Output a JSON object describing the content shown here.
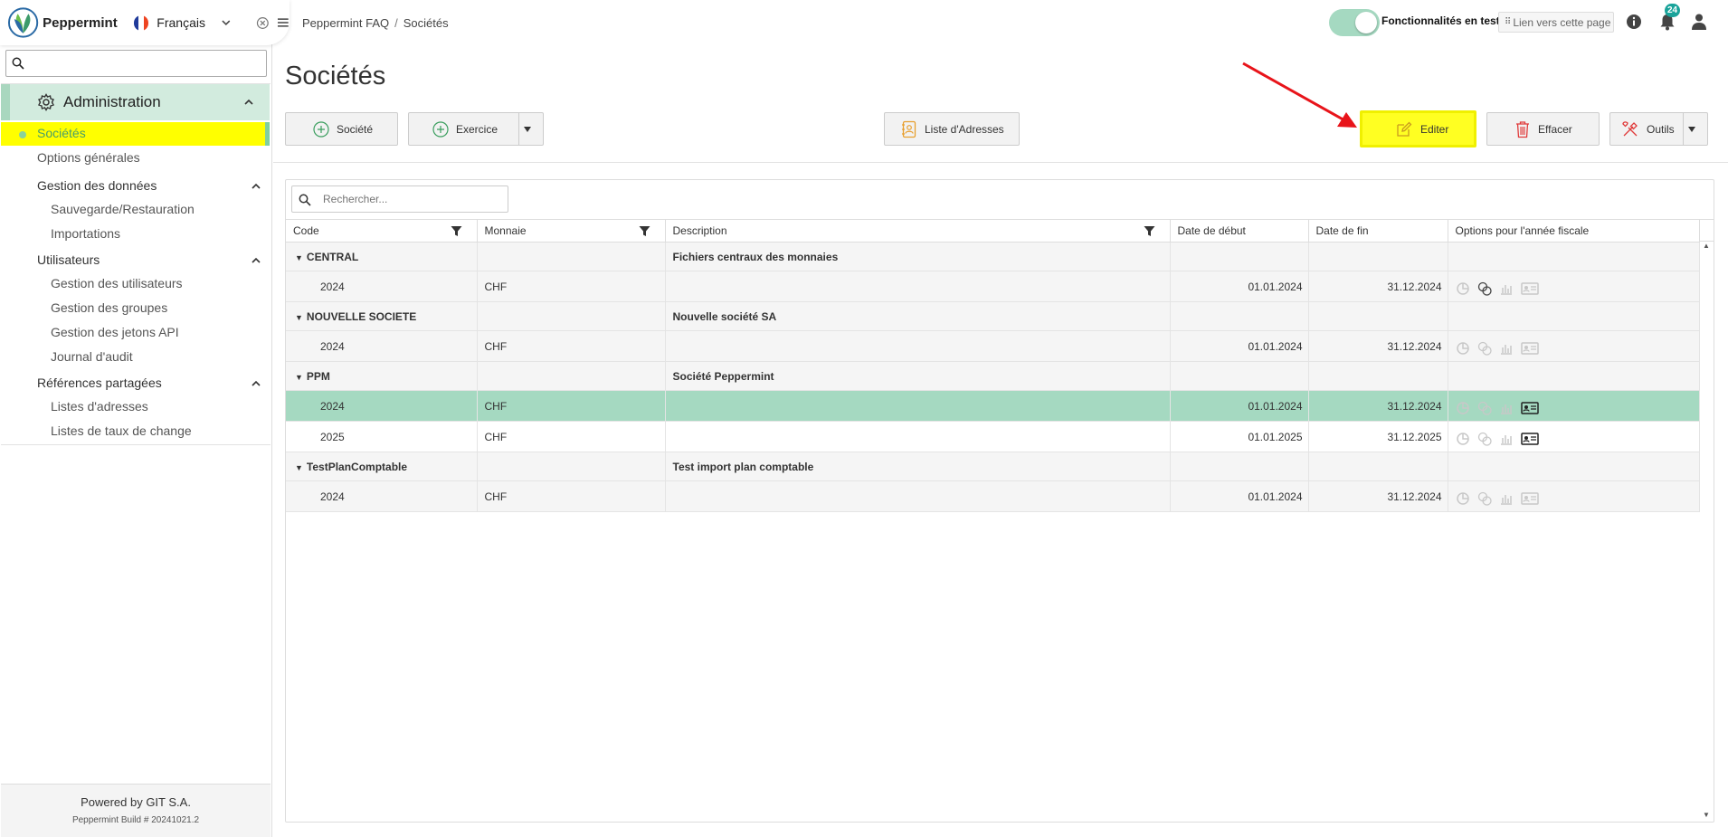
{
  "app": {
    "name": "Peppermint",
    "language": "Français"
  },
  "sidebar": {
    "search_placeholder": "",
    "section": "Administration",
    "active_item": "Sociétés",
    "options": "Options générales",
    "groups": [
      {
        "label": "Gestion des données",
        "items": [
          "Sauvegarde/Restauration",
          "Importations"
        ]
      },
      {
        "label": "Utilisateurs",
        "items": [
          "Gestion des utilisateurs",
          "Gestion des groupes",
          "Gestion des jetons API",
          "Journal d'audit"
        ]
      },
      {
        "label": "Références partagées",
        "items": [
          "Listes d'adresses",
          "Listes de taux de change"
        ]
      }
    ],
    "footer": {
      "powered": "Powered by GIT S.A.",
      "build": "Peppermint Build # 20241021.2"
    }
  },
  "topbar": {
    "breadcrumb": [
      "Peppermint FAQ",
      "Sociétés"
    ],
    "feature_toggle_label": "Fonctionnalités en test",
    "link_label": "Lien vers cette page",
    "notification_count": "24"
  },
  "page": {
    "title": "Sociétés",
    "toolbar": {
      "societe": "Société",
      "exercice": "Exercice",
      "liste_adresses": "Liste d'Adresses",
      "editer": "Editer",
      "effacer": "Effacer",
      "outils": "Outils"
    }
  },
  "grid": {
    "search_placeholder": "Rechercher...",
    "columns": [
      "Code",
      "Monnaie",
      "Description",
      "Date de début",
      "Date de fin",
      "Options pour l'année fiscale"
    ],
    "groups": [
      {
        "code": "CENTRAL",
        "description": "Fichiers centraux des monnaies",
        "rows": [
          {
            "year": "2024",
            "currency": "CHF",
            "start": "01.01.2024",
            "end": "31.12.2024"
          }
        ]
      },
      {
        "code": "NOUVELLE SOCIETE",
        "description": "Nouvelle société SA",
        "rows": [
          {
            "year": "2024",
            "currency": "CHF",
            "start": "01.01.2024",
            "end": "31.12.2024"
          }
        ]
      },
      {
        "code": "PPM",
        "description": "Société Peppermint",
        "rows": [
          {
            "year": "2024",
            "currency": "CHF",
            "start": "01.01.2024",
            "end": "31.12.2024"
          },
          {
            "year": "2025",
            "currency": "CHF",
            "start": "01.01.2025",
            "end": "31.12.2025"
          }
        ]
      },
      {
        "code": "TestPlanComptable",
        "description": "Test import plan comptable",
        "rows": [
          {
            "year": "2024",
            "currency": "CHF",
            "start": "01.01.2024",
            "end": "31.12.2024"
          }
        ]
      }
    ]
  },
  "colors": {
    "accent_green": "#a5d9c1",
    "highlight_yellow": "#ffff00",
    "arrow_red": "#e8141a"
  }
}
